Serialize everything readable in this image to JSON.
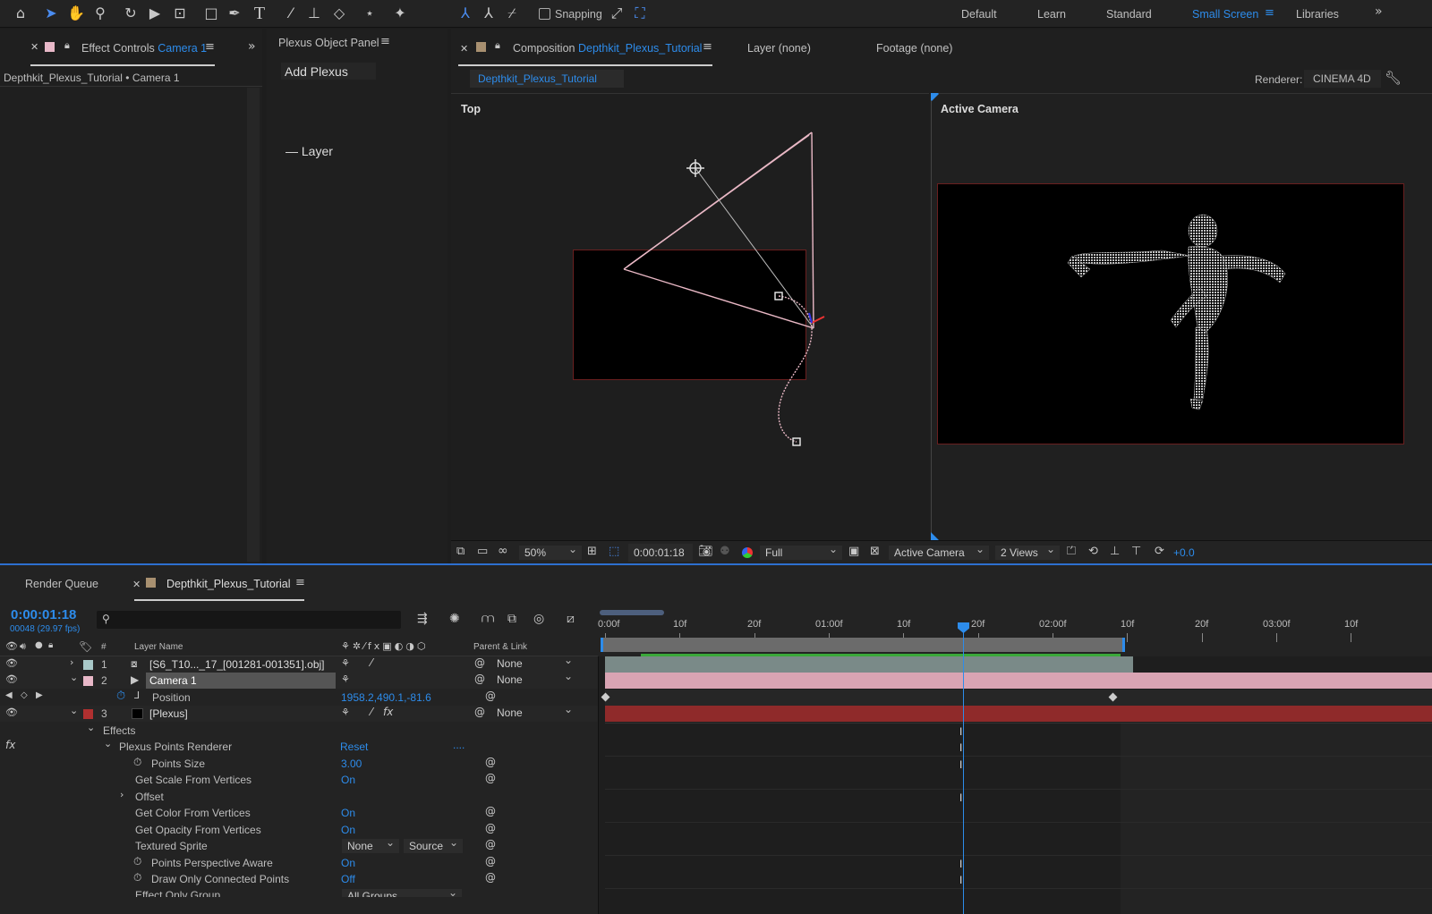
{
  "toolbar": {
    "snapping_label": "Snapping",
    "workspaces": [
      "Default",
      "Learn",
      "Standard",
      "Small Screen",
      "Libraries"
    ],
    "active_workspace": "Small Screen"
  },
  "effect_controls": {
    "tab_prefix": "Effect Controls",
    "tab_target": "Camera 1",
    "breadcrumb": "Depthkit_Plexus_Tutorial • Camera 1"
  },
  "plexus_panel": {
    "title": "Plexus Object Panel",
    "add_button": "Add Plexus",
    "layer_item": "— Layer"
  },
  "composition": {
    "tab_prefix": "Composition",
    "tab_name": "Depthkit_Plexus_Tutorial",
    "layer_tab": "Layer (none)",
    "footage_tab": "Footage (none)",
    "sub_tab": "Depthkit_Plexus_Tutorial",
    "renderer_label": "Renderer:",
    "renderer_value": "CINEMA 4D",
    "view_left": "Top",
    "view_right": "Active Camera",
    "zoom": "50%",
    "timecode": "0:00:01:18",
    "resolution": "Full",
    "camera": "Active Camera",
    "views": "2 Views",
    "exposure": "+0.0"
  },
  "timeline": {
    "render_queue_tab": "Render Queue",
    "comp_tab": "Depthkit_Plexus_Tutorial",
    "current_time": "0:00:01:18",
    "frame_info": "00048 (29.97 fps)",
    "col_layer_name": "Layer Name",
    "col_num": "#",
    "col_parent": "Parent & Link",
    "ruler": [
      "0:00f",
      "10f",
      "20f",
      "01:00f",
      "10f",
      "20f",
      "02:00f",
      "10f",
      "20f",
      "03:00f",
      "10f"
    ],
    "layers": [
      {
        "num": "1",
        "name": "[S6_T10..._17_[001281-001351].obj]",
        "parent": "None",
        "color": "#a8c8c8"
      },
      {
        "num": "2",
        "name": "Camera 1",
        "parent": "None",
        "color": "#e8b8c8"
      },
      {
        "num": "3",
        "name": "[Plexus]",
        "parent": "None",
        "color": "#b03030"
      }
    ],
    "position": {
      "label": "Position",
      "value": "1958.2,490.1,-81.6"
    },
    "effects_label": "Effects",
    "renderer_name": "Plexus Points Renderer",
    "reset": "Reset",
    "more": "....",
    "props": [
      {
        "label": "Points Size",
        "value": "3.00"
      },
      {
        "label": "Get Scale From Vertices",
        "value": "On"
      },
      {
        "label": "Offset",
        "value": ""
      },
      {
        "label": "Get Color From Vertices",
        "value": "On"
      },
      {
        "label": "Get Opacity From Vertices",
        "value": "On"
      },
      {
        "label": "Textured Sprite",
        "value": ""
      },
      {
        "label": "Points Perspective Aware",
        "value": "On"
      },
      {
        "label": "Draw Only Connected Points",
        "value": "Off"
      },
      {
        "label": "Effect Only Group",
        "value": "All Groups"
      }
    ],
    "sprite_options": [
      "None",
      "Source"
    ]
  }
}
